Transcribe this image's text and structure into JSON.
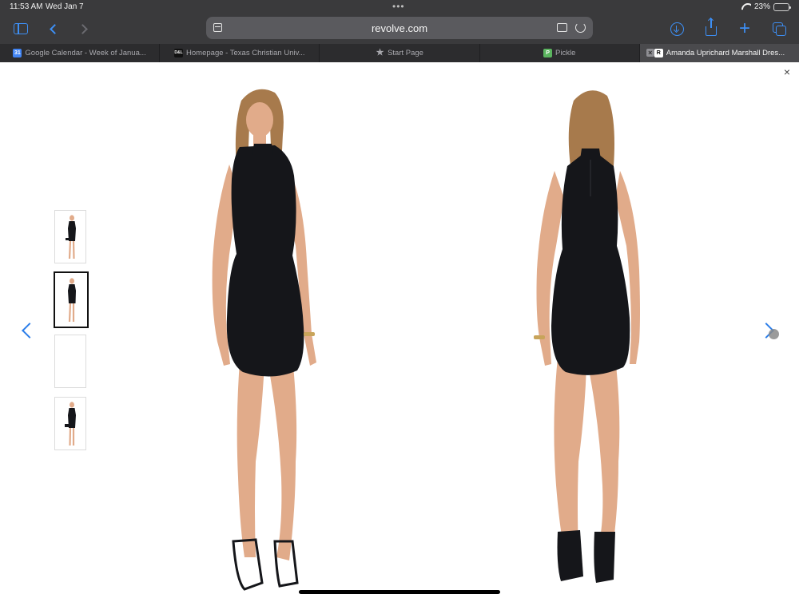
{
  "status_bar": {
    "time": "11:53 AM",
    "date": "Wed Jan 7",
    "battery_text": "23%",
    "battery_level": 0.23
  },
  "toolbar": {
    "url": "revolve.com"
  },
  "tabs": [
    {
      "label": "Google Calendar - Week of Janua...",
      "favicon": "calendar-favicon",
      "favicon_text": "31",
      "favicon_color": "#4285f4"
    },
    {
      "label": "Homepage - Texas Christian Univ...",
      "favicon": "tcu-favicon",
      "favicon_text": "D&L",
      "favicon_color": "#111111"
    },
    {
      "label": "Start Page",
      "favicon": "star-icon"
    },
    {
      "label": "Pickle",
      "favicon": "pickle-favicon",
      "favicon_text": "P",
      "favicon_color": "#5bb55f"
    },
    {
      "label": "Amanda Uprichard Marshall Dres...",
      "favicon": "revolve-favicon",
      "favicon_text": "R",
      "favicon_color": "#ffffff",
      "active": true
    }
  ],
  "gallery": {
    "thumbnail_count": 4,
    "selected_index": 1,
    "dress_color": "#15161a",
    "skin_color": "#e1ab8a",
    "hair_color": "#a77a4c",
    "accent_color": "#2b7de9"
  }
}
